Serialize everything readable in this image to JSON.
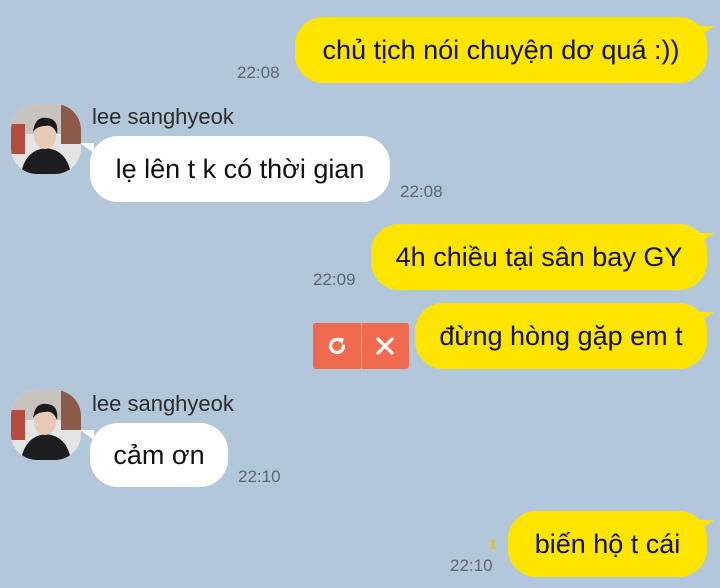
{
  "messages": [
    {
      "sender": "me",
      "text": "chủ tịch nói chuyện dơ quá :))",
      "time": "22:08"
    },
    {
      "sender": "lee sanghyeok",
      "text": "lẹ lên t k có thời gian",
      "time": "22:08"
    },
    {
      "sender": "me",
      "text": "4h chiều tại sân bay GY",
      "time": "22:09"
    },
    {
      "sender": "me",
      "text": "đừng hòng gặp em t",
      "time": "",
      "status": "failed"
    },
    {
      "sender": "lee sanghyeok",
      "text": "cảm ơn",
      "time": "22:10"
    },
    {
      "sender": "me",
      "text": "biến hộ t cái",
      "time": "22:10",
      "unread": "1"
    }
  ],
  "contact": {
    "name": "lee sanghyeok",
    "avatar_icon": "profile-photo"
  },
  "failed_actions": {
    "retry_icon": "retry-icon",
    "delete_icon": "close-icon"
  },
  "colors": {
    "background": "#b2c7d9",
    "my_bubble": "#fee500",
    "their_bubble": "#ffffff",
    "failed_button": "#f06a4f",
    "unread_count": "#f2c200"
  }
}
